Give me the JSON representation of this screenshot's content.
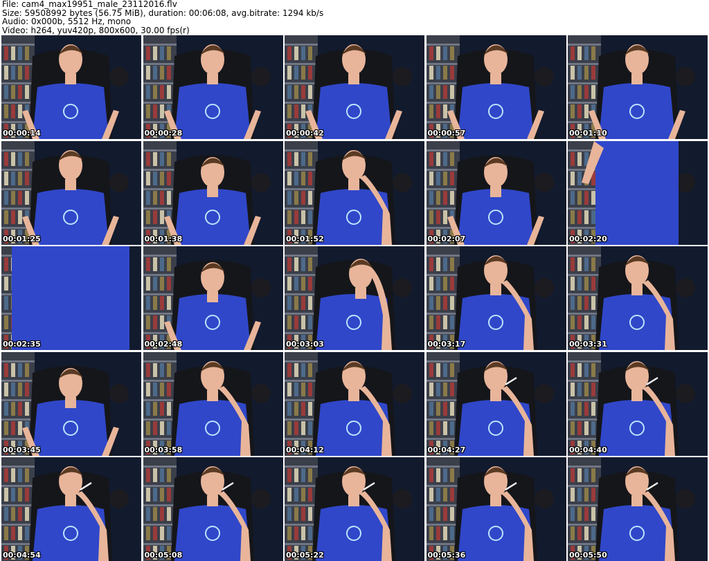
{
  "file_info": {
    "file": "File: cam4_max19951_male_23112016.flv",
    "size": "Size: 59508992 bytes (56.75 MiB), duration: 00:06:08, avg.bitrate: 1294 kb/s",
    "audio": "Audio: 0x000b, 5512 Hz, mono",
    "video": "Video: h264, yuv420p, 800x600, 30.00 fps(r)"
  },
  "thumbnails": [
    {
      "timestamp": "00:00:14",
      "pose": "center"
    },
    {
      "timestamp": "00:00:28",
      "pose": "center"
    },
    {
      "timestamp": "00:00:42",
      "pose": "center"
    },
    {
      "timestamp": "00:00:57",
      "pose": "center"
    },
    {
      "timestamp": "00:01:10",
      "pose": "center"
    },
    {
      "timestamp": "00:01:25",
      "pose": "center"
    },
    {
      "timestamp": "00:01:38",
      "pose": "head-down"
    },
    {
      "timestamp": "00:01:52",
      "pose": "hand-chin"
    },
    {
      "timestamp": "00:02:07",
      "pose": "head-down"
    },
    {
      "timestamp": "00:02:20",
      "pose": "standing-arm-up"
    },
    {
      "timestamp": "00:02:35",
      "pose": "torso-close"
    },
    {
      "timestamp": "00:02:48",
      "pose": "head-down"
    },
    {
      "timestamp": "00:03:03",
      "pose": "hand-forehead"
    },
    {
      "timestamp": "00:03:17",
      "pose": "hand-chin"
    },
    {
      "timestamp": "00:03:31",
      "pose": "hand-chin"
    },
    {
      "timestamp": "00:03:45",
      "pose": "head-down"
    },
    {
      "timestamp": "00:03:58",
      "pose": "hand-mouth"
    },
    {
      "timestamp": "00:04:12",
      "pose": "hand-mouth"
    },
    {
      "timestamp": "00:04:27",
      "pose": "smoking"
    },
    {
      "timestamp": "00:04:40",
      "pose": "smoking"
    },
    {
      "timestamp": "00:04:54",
      "pose": "smoking"
    },
    {
      "timestamp": "00:05:08",
      "pose": "smoking"
    },
    {
      "timestamp": "00:05:22",
      "pose": "smoking"
    },
    {
      "timestamp": "00:05:36",
      "pose": "smoking"
    },
    {
      "timestamp": "00:05:50",
      "pose": "smoking"
    }
  ],
  "colors": {
    "background": "#ffffff",
    "header_text": "#000000",
    "timestamp_text": "#ffffff",
    "timestamp_outline": "#000000",
    "room_dark": "#121a2e",
    "shirt_blue": "#2f47c8",
    "skin": "#e8b49a",
    "hair": "#5a3a22",
    "shelf": "#3a3f4a",
    "chair": "#15161a"
  }
}
